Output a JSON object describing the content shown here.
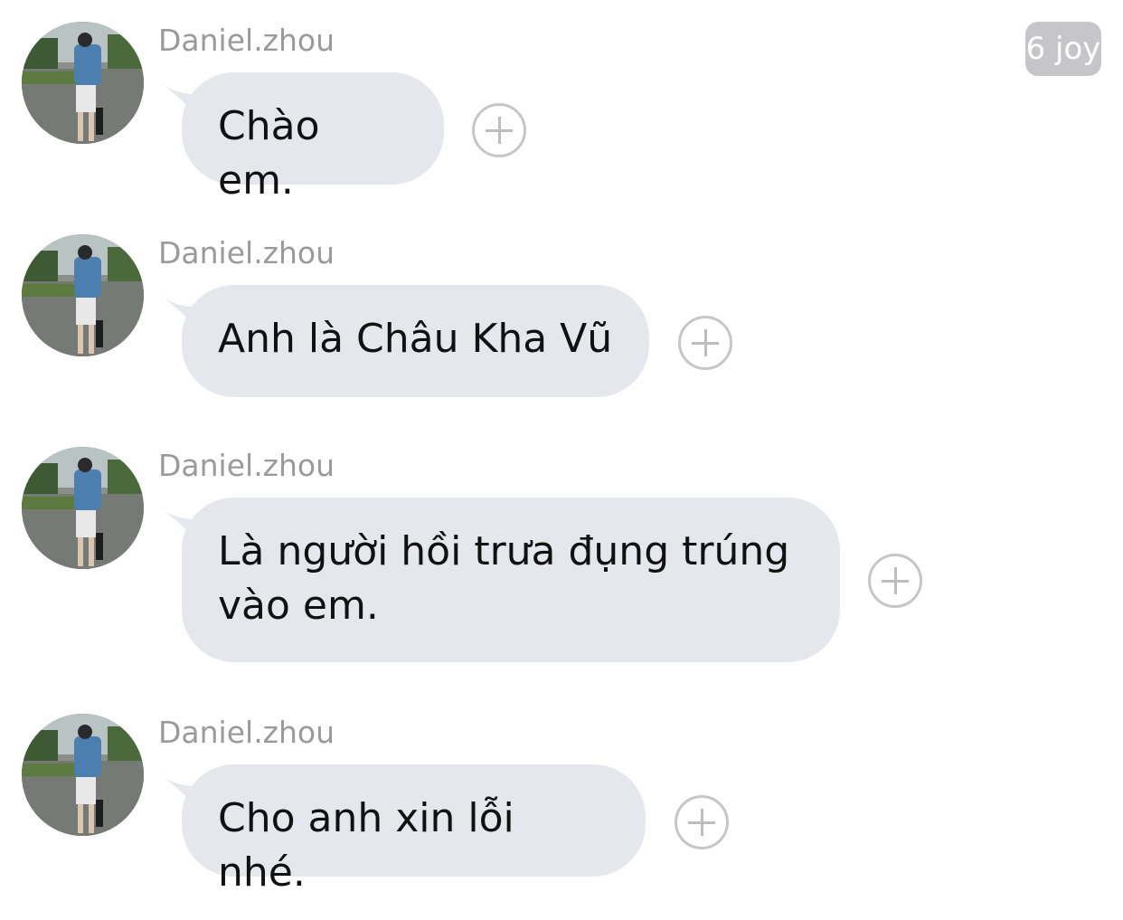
{
  "watermark": "6 joy",
  "messages": [
    {
      "sender": "Daniel.zhou",
      "text": "Chào em.",
      "avatar_icon": "profile-photo",
      "action_icon": "add-reaction-icon"
    },
    {
      "sender": "Daniel.zhou",
      "text": "Anh là Châu Kha Vũ",
      "avatar_icon": "profile-photo",
      "action_icon": "add-reaction-icon"
    },
    {
      "sender": "Daniel.zhou",
      "text": "Là người hồi trưa đụng trúng vào em.",
      "avatar_icon": "profile-photo",
      "action_icon": "add-reaction-icon"
    },
    {
      "sender": "Daniel.zhou",
      "text": "Cho anh xin lỗi nhé.",
      "avatar_icon": "profile-photo",
      "action_icon": "add-reaction-icon"
    }
  ],
  "colors": {
    "bubble": "#e4e8ec",
    "sender_text": "#9a9a9a",
    "message_text": "#111111",
    "plus_icon": "#c6c6c8"
  }
}
